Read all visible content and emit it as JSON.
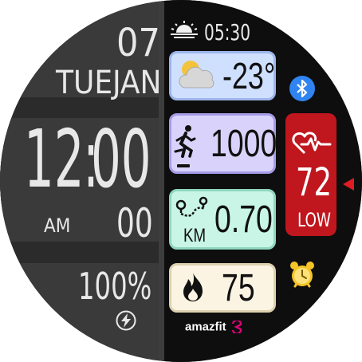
{
  "date": {
    "day": "07",
    "weekday": "TUE",
    "month": "JAN"
  },
  "time": {
    "hours": "12",
    "minutes": "00",
    "seconds": "00",
    "ampm": "AM"
  },
  "battery": {
    "value": "100%"
  },
  "sunrise": {
    "time": "05:30"
  },
  "weather": {
    "temperature": "-23°"
  },
  "steps": {
    "value": "1000"
  },
  "distance": {
    "value": "0.70",
    "unit": "KM"
  },
  "calories": {
    "value": "75"
  },
  "heart_rate": {
    "value": "72",
    "zone": "LOW"
  },
  "brand": {
    "logo": "amazfit"
  },
  "icons": [
    "sunrise-icon",
    "weather-cloud-icon",
    "bluetooth-icon",
    "steps-runner-icon",
    "distance-route-icon",
    "calories-flame-icon",
    "heart-rate-icon",
    "alarm-clock-icon",
    "charging-bolt-icon",
    "pointer-triangle-icon"
  ],
  "colors": {
    "weather_tile": "#cfe0ff",
    "steps_tile": "#d9d3fb",
    "distance_tile": "#c8f5e6",
    "calories_tile": "#fbf4e2",
    "heart_card": "#c0161d",
    "bluetooth": "#2f84f1",
    "alarm": "#f6c428",
    "pointer": "#e01b24"
  }
}
